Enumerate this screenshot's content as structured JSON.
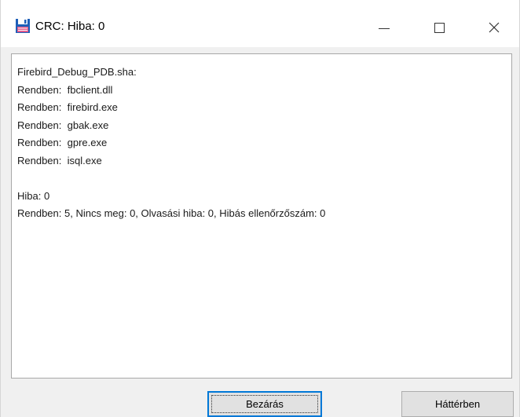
{
  "window": {
    "title": "CRC: Hiba: 0",
    "icon": "floppy-disk-icon"
  },
  "controls": {
    "minimize": "minimize-icon",
    "maximize": "maximize-icon",
    "close": "close-icon"
  },
  "log": {
    "lines": [
      "Firebird_Debug_PDB.sha:",
      "Rendben:  fbclient.dll",
      "Rendben:  firebird.exe",
      "Rendben:  gbak.exe",
      "Rendben:  gpre.exe",
      "Rendben:  isql.exe",
      "",
      "Hiba: 0",
      "Rendben: 5, Nincs meg: 0, Olvasási hiba: 0, Hibás ellenőrzőszám: 0"
    ]
  },
  "buttons": {
    "close_label": "Bezárás",
    "background_label": "Háttérben"
  },
  "colors": {
    "accent": "#0078d7",
    "icon_red": "#c2185b",
    "icon_blue": "#1e5fb8"
  }
}
